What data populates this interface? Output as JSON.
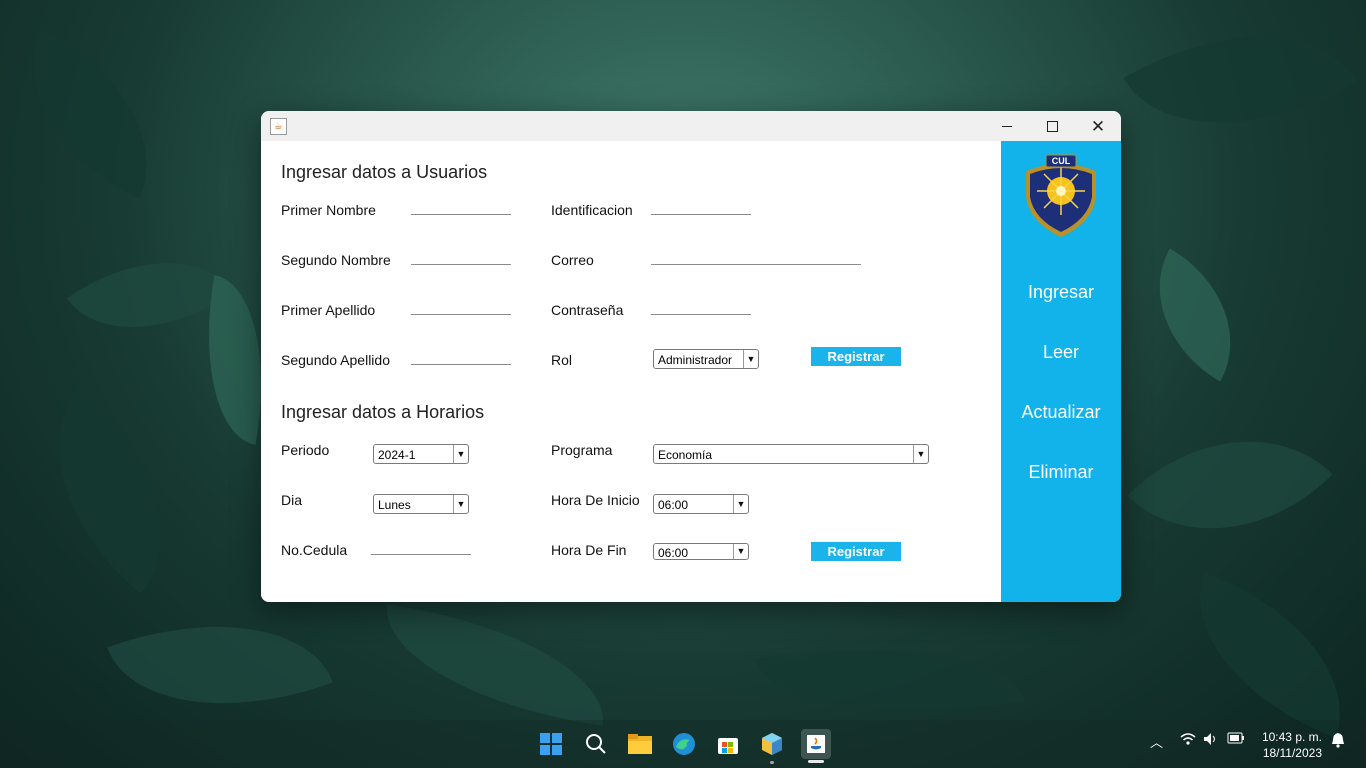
{
  "window": {
    "title": "",
    "controls": {
      "minimize": "minimize",
      "maximize": "maximize",
      "close": "✕"
    }
  },
  "usuarios": {
    "title": "Ingresar datos a Usuarios",
    "labels": {
      "primer_nombre": "Primer Nombre",
      "segundo_nombre": "Segundo Nombre",
      "primer_apellido": "Primer Apellido",
      "segundo_apellido": "Segundo Apellido",
      "identificacion": "Identificacion",
      "correo": "Correo",
      "contrasena": "Contraseña",
      "rol": "Rol"
    },
    "values": {
      "primer_nombre": "",
      "segundo_nombre": "",
      "primer_apellido": "",
      "segundo_apellido": "",
      "identificacion": "",
      "correo": "",
      "contrasena": ""
    },
    "rol_selected": "Administrador",
    "register_button": "Registrar"
  },
  "horarios": {
    "title": "Ingresar datos a Horarios",
    "labels": {
      "periodo": "Periodo",
      "dia": "Dia",
      "cedula": "No.Cedula",
      "programa": "Programa",
      "hora_inicio": "Hora De Inicio",
      "hora_fin": "Hora De Fin"
    },
    "periodo_selected": "2024-1",
    "dia_selected": "Lunes",
    "programa_selected": "Economía",
    "hora_inicio_selected": "06:00",
    "hora_fin_selected": "06:00",
    "cedula_value": "",
    "register_button": "Registrar"
  },
  "side_panel": {
    "logo_text": "CUL",
    "nav": [
      "Ingresar",
      "Leer",
      "Actualizar",
      "Eliminar"
    ]
  },
  "taskbar": {
    "icons": [
      "windows-start-icon",
      "search-icon",
      "file-explorer-icon",
      "edge-browser-icon",
      "microsoft-store-icon",
      "netbeans-icon",
      "java-app-icon"
    ],
    "time": "10:43 p. m.",
    "date": "18/11/2023"
  },
  "colors": {
    "accent": "#12b2ea",
    "button": "#1ab3ea"
  }
}
